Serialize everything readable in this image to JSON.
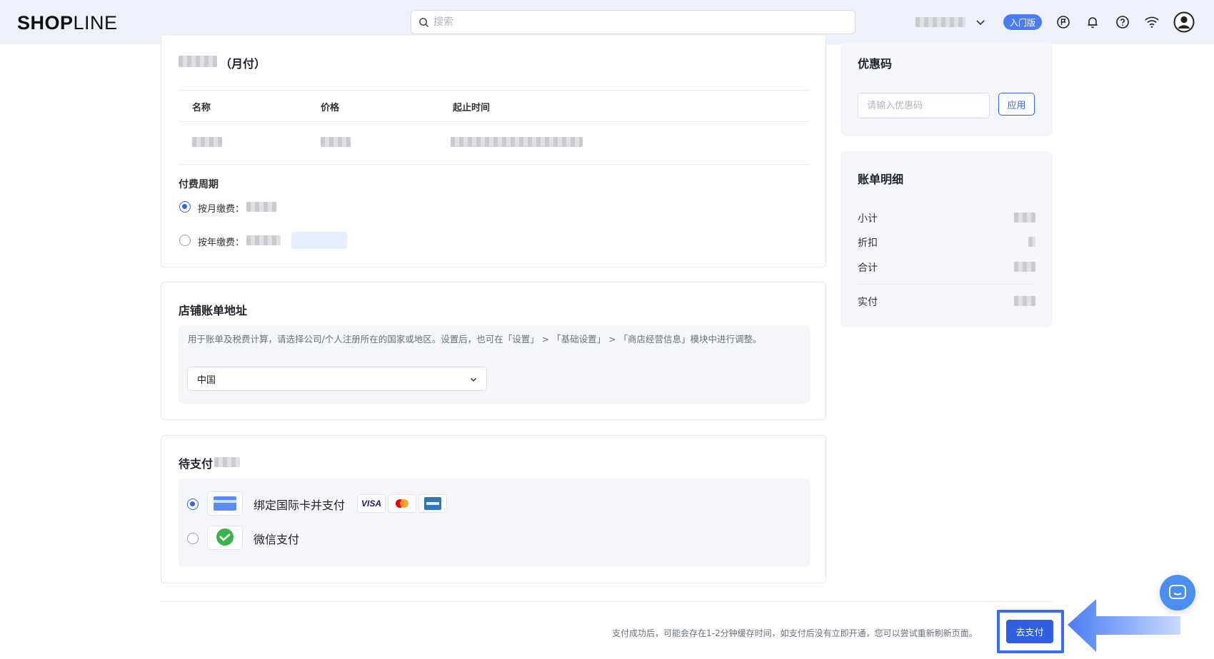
{
  "topbar": {
    "logo_bold": "SHOP",
    "logo_thin": "LINE",
    "search_placeholder": "搜索",
    "plan_badge": "入门版",
    "icons": [
      "search-icon",
      "chevron-down-icon",
      "flag-icon",
      "bell-icon",
      "help-icon",
      "wifi-icon",
      "user-avatar-icon"
    ]
  },
  "plan": {
    "title_suffix": "（月付）",
    "columns": [
      "名称",
      "价格",
      "起止时间"
    ],
    "billing_cycle_title": "付费周期",
    "monthly_label": "按月缴费：",
    "yearly_label": "按年缴费：",
    "selected_cycle": "monthly"
  },
  "address": {
    "title": "店铺账单地址",
    "hint": "用于账单及税费计算，请选择公司/个人注册所在的国家或地区。设置后，也可在「设置」 > 「基础设置」 > 「商店经营信息」模块中进行调整。",
    "country": "中国"
  },
  "payment": {
    "title": "待支付",
    "methods": [
      {
        "label": "绑定国际卡并支付",
        "selected": true
      },
      {
        "label": "微信支付",
        "selected": false
      }
    ],
    "card_brands": [
      "VISA",
      "Mastercard",
      "American Express"
    ]
  },
  "coupon": {
    "title": "优惠码",
    "placeholder": "请输入优惠码",
    "apply_label": "应用"
  },
  "bill": {
    "title": "账单明细",
    "rows": [
      "小计",
      "折扣",
      "合计"
    ],
    "paid_label": "实付"
  },
  "footer": {
    "note": "支付成功后，可能会存在1-2分钟缓存时间，如支付后没有立即开通，您可以尝试重新刷新页面。",
    "pay_button": "去支付"
  },
  "colors": {
    "primary": "#2f5fe0",
    "accent_arrow": "#4a7cf3",
    "topbar_bg": "#eef1fb"
  }
}
